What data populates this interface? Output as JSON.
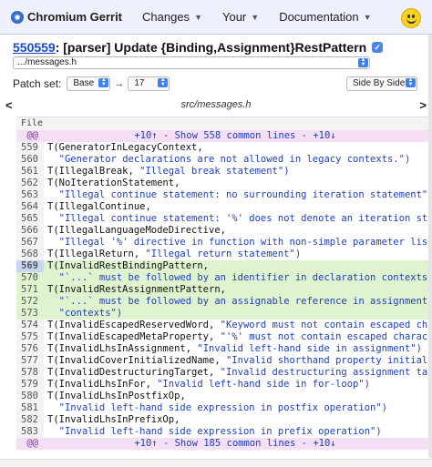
{
  "header": {
    "brand": "Chromium Gerrit",
    "nav": [
      "Changes",
      "Your",
      "Documentation"
    ]
  },
  "change": {
    "number": "550559",
    "subject": ": [parser] Update {Binding,Assignment}RestPattern"
  },
  "file_select": {
    "value": ".../messages.h"
  },
  "patch": {
    "label": "Patch set:",
    "base": "Base",
    "arrow": "→",
    "target": "17",
    "mode": "Side By Side"
  },
  "file_nav": {
    "prev": "<",
    "next": ">",
    "path": "src/messages.h"
  },
  "diff": {
    "header": "File",
    "skip_top": {
      "marker": "@@",
      "text": "+10↑ - Show 558 common lines - +10↓"
    },
    "skip_bottom": {
      "marker": "@@",
      "text": "+10↑ - Show 185 common lines - +10↓"
    },
    "lines": [
      {
        "n": "559",
        "code": "T(GeneratorInLegacyContext,",
        "str": ""
      },
      {
        "n": "560",
        "code": "  ",
        "str": "\"Generator declarations are not allowed in legacy contexts.\")"
      },
      {
        "n": "561",
        "code": "T(IllegalBreak, ",
        "str": "\"Illegal break statement\")"
      },
      {
        "n": "562",
        "code": "T(NoIterationStatement,",
        "str": ""
      },
      {
        "n": "563",
        "code": "  ",
        "str": "\"Illegal continue statement: no surrounding iteration statement\")"
      },
      {
        "n": "564",
        "code": "T(IllegalContinue,",
        "str": ""
      },
      {
        "n": "565",
        "code": "  ",
        "str": "\"Illegal continue statement: '%' does not denote an iteration statement"
      },
      {
        "n": "566",
        "code": "T(IllegalLanguageModeDirective,",
        "str": ""
      },
      {
        "n": "567",
        "code": "  ",
        "str": "\"Illegal '%' directive in function with non-simple parameter list\")"
      },
      {
        "n": "568",
        "code": "T(IllegalReturn, ",
        "str": "\"Illegal return statement\")"
      },
      {
        "n": "569",
        "code": "T(InvalidRestBindingPattern,",
        "str": "",
        "hl": true,
        "sel": true
      },
      {
        "n": "570",
        "code": "  ",
        "str": "\"`...` must be followed by an identifier in declaration contexts\")",
        "hl": true
      },
      {
        "n": "571",
        "code": "T(InvalidRestAssignmentPattern,",
        "str": "",
        "hl": true
      },
      {
        "n": "572",
        "code": "  ",
        "str": "\"`...` must be followed by an assignable reference in assignment \"",
        "hl": true
      },
      {
        "n": "573",
        "code": "  ",
        "str": "\"contexts\")",
        "hl": true
      },
      {
        "n": "574",
        "code": "T(InvalidEscapedReservedWord, ",
        "str": "\"Keyword must not contain escaped characters\")"
      },
      {
        "n": "575",
        "code": "T(InvalidEscapedMetaProperty, ",
        "str": "\"'%' must not contain escaped characters\")"
      },
      {
        "n": "576",
        "code": "T(InvalidLhsInAssignment, ",
        "str": "\"Invalid left-hand side in assignment\")"
      },
      {
        "n": "577",
        "code": "T(InvalidCoverInitializedName, ",
        "str": "\"Invalid shorthand property initializer\")"
      },
      {
        "n": "578",
        "code": "T(InvalidDestructuringTarget, ",
        "str": "\"Invalid destructuring assignment target\")"
      },
      {
        "n": "579",
        "code": "T(InvalidLhsInFor, ",
        "str": "\"Invalid left-hand side in for-loop\")"
      },
      {
        "n": "580",
        "code": "T(InvalidLhsInPostfixOp,",
        "str": ""
      },
      {
        "n": "581",
        "code": "  ",
        "str": "\"Invalid left-hand side expression in postfix operation\")"
      },
      {
        "n": "582",
        "code": "T(InvalidLhsInPrefixOp,",
        "str": ""
      },
      {
        "n": "583",
        "code": "  ",
        "str": "\"Invalid left-hand side expression in prefix operation\")"
      }
    ]
  },
  "colors": {
    "header_bg": "#eef0fb",
    "link": "#1a49c7",
    "string": "#1f3fb8",
    "added_bg": "#dff3cf",
    "skip_bg": "#f4dff4"
  }
}
